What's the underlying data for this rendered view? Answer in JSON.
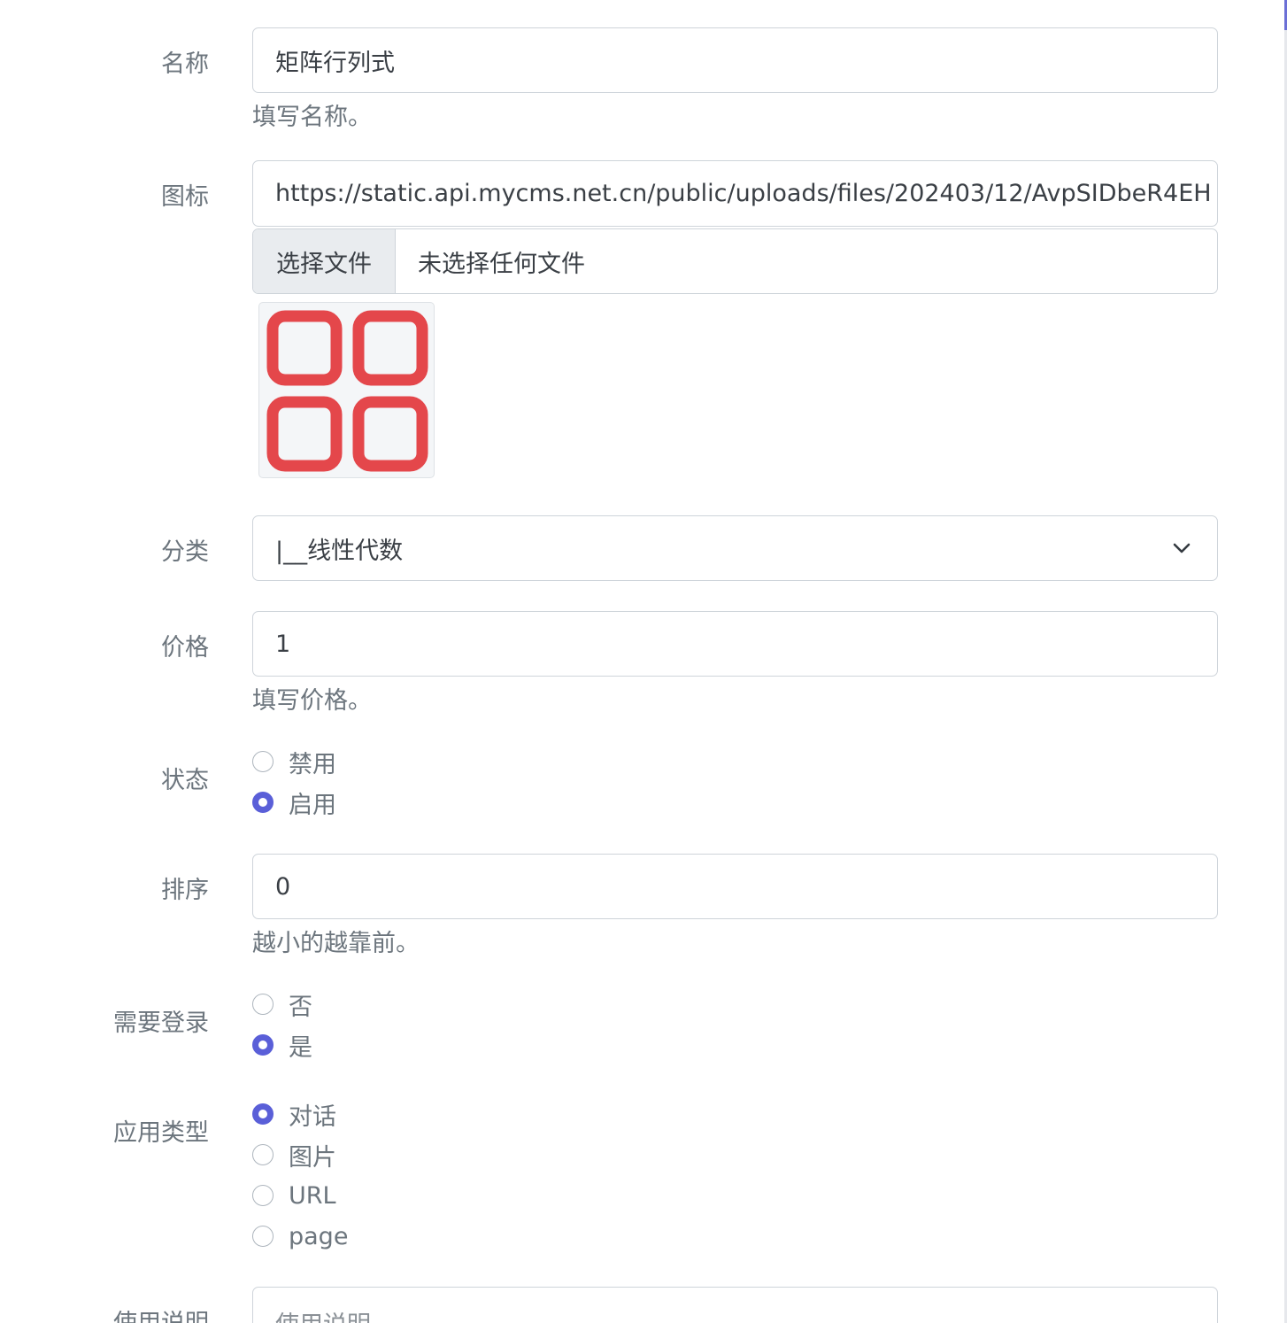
{
  "form": {
    "name": {
      "label": "名称",
      "value": "矩阵行列式",
      "help": "填写名称。"
    },
    "icon": {
      "label": "图标",
      "value": "https://static.api.mycms.net.cn/public/uploads/files/202403/12/AvpSIDbeR4EH",
      "file_button": "选择文件",
      "file_status": "未选择任何文件",
      "preview_icon": "grid-four-squares-icon",
      "preview_color": "#e4474b"
    },
    "category": {
      "label": "分类",
      "selected": "|__线性代数"
    },
    "price": {
      "label": "价格",
      "value": "1",
      "help": "填写价格。"
    },
    "status": {
      "label": "状态",
      "options": [
        {
          "label": "禁用",
          "checked": false
        },
        {
          "label": "启用",
          "checked": true
        }
      ]
    },
    "sort": {
      "label": "排序",
      "value": "0",
      "help": "越小的越靠前。"
    },
    "login_required": {
      "label": "需要登录",
      "options": [
        {
          "label": "否",
          "checked": false
        },
        {
          "label": "是",
          "checked": true
        }
      ]
    },
    "app_type": {
      "label": "应用类型",
      "options": [
        {
          "label": "对话",
          "checked": true
        },
        {
          "label": "图片",
          "checked": false
        },
        {
          "label": "URL",
          "checked": false
        },
        {
          "label": "page",
          "checked": false
        }
      ]
    },
    "usage": {
      "label": "使用说明",
      "placeholder": "使用说明"
    }
  },
  "colors": {
    "accent": "#5a5fd8",
    "border": "#ced4da",
    "muted_text": "#6c757d"
  }
}
